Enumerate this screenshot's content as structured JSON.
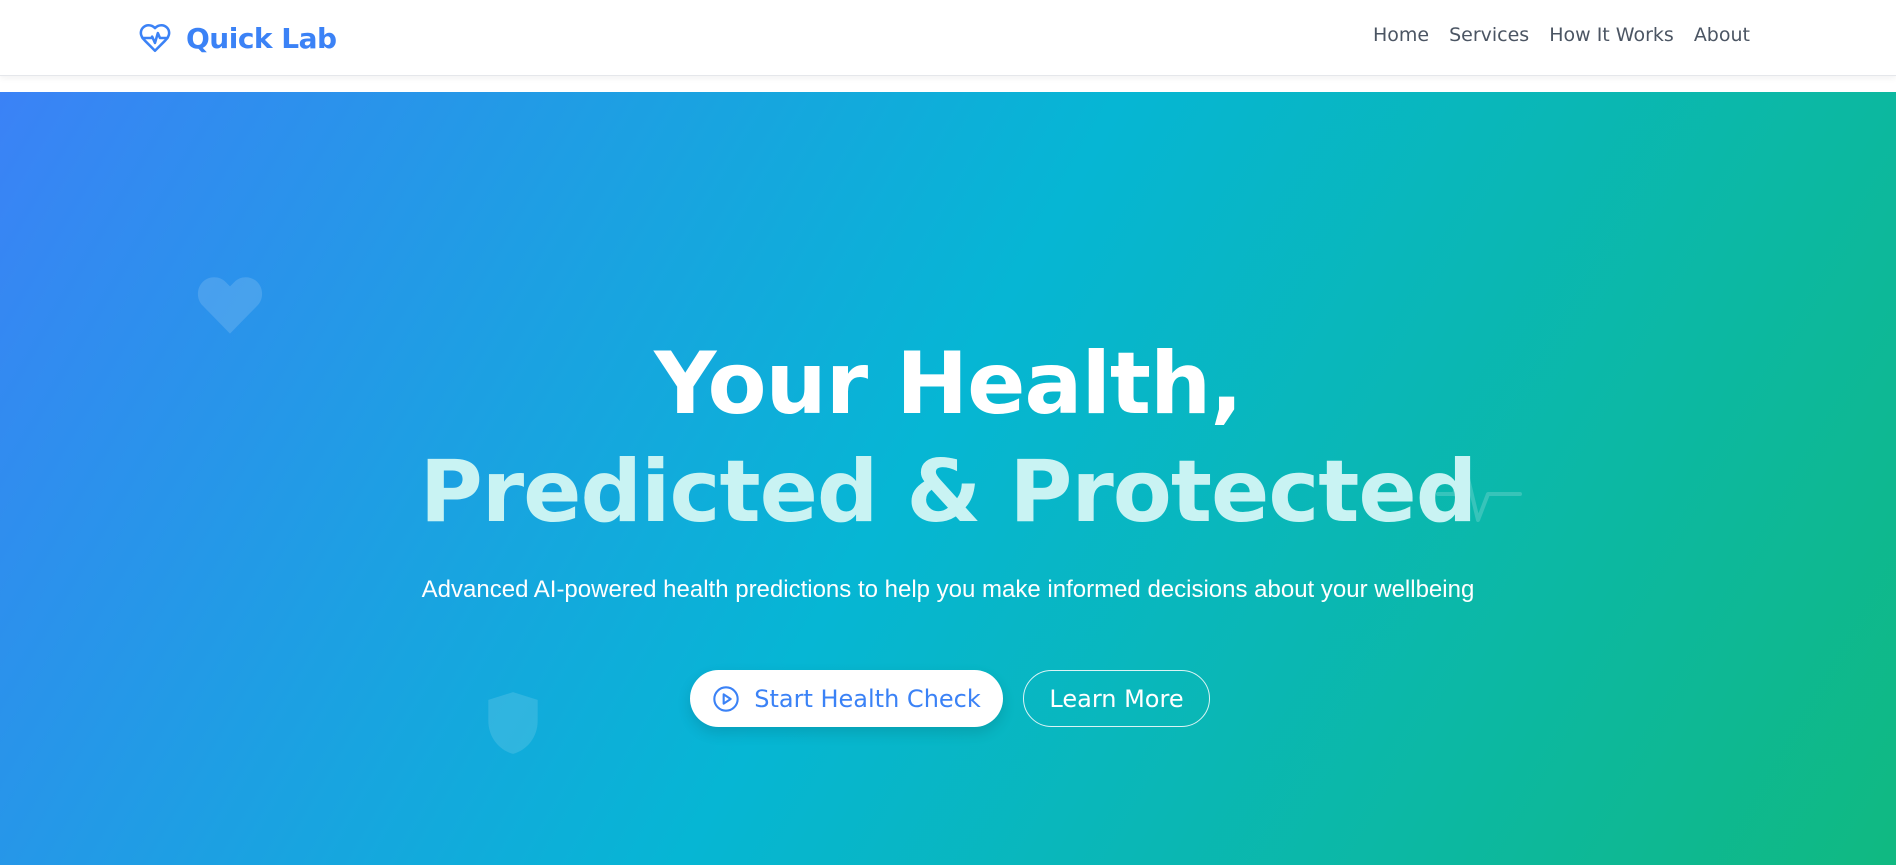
{
  "brand": {
    "name": "Quick Lab",
    "icon": "heart-pulse-icon",
    "color": "#3b82f6"
  },
  "nav": {
    "items": [
      {
        "label": "Home"
      },
      {
        "label": "Services"
      },
      {
        "label": "How It Works"
      },
      {
        "label": "About"
      }
    ]
  },
  "hero": {
    "title_line_1": "Your Health,",
    "title_line_2": "Predicted & Protected",
    "subtitle": "Advanced AI-powered health predictions to help you make informed decisions about your wellbeing",
    "primary_button": {
      "label": "Start Health Check",
      "icon": "play-circle-icon"
    },
    "secondary_button": {
      "label": "Learn More"
    },
    "decorations": [
      "heart-icon",
      "shield-icon",
      "pulse-icon"
    ],
    "gradient": [
      "#3b82f6",
      "#06b6d4",
      "#10b981"
    ]
  }
}
